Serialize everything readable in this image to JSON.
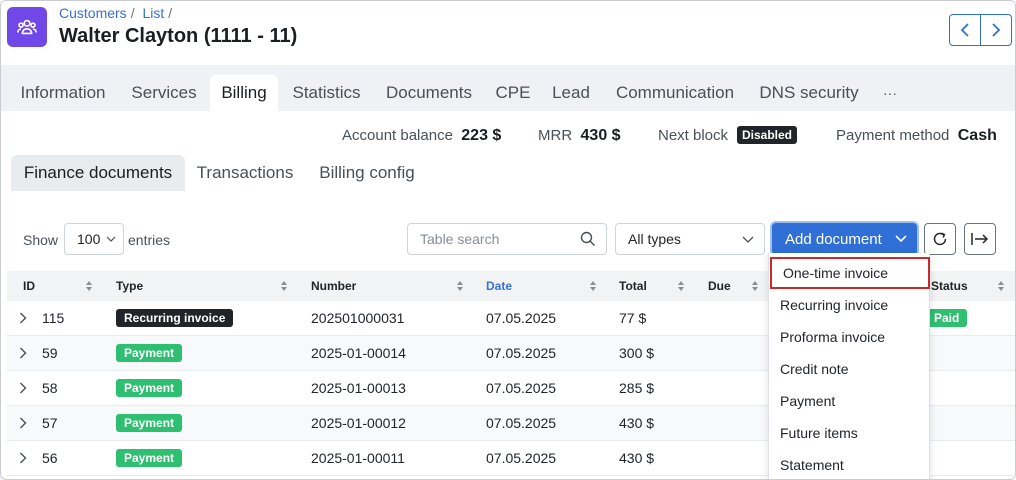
{
  "header": {
    "breadcrumb": [
      "Customers",
      "List"
    ],
    "breadcrumb_sep": "/",
    "title": "Walter Clayton (1111 - 11)",
    "app_icon": "users-group-icon"
  },
  "tabs": [
    "Information",
    "Services",
    "Billing",
    "Statistics",
    "Documents",
    "CPE",
    "Lead",
    "Communication",
    "DNS security",
    "···"
  ],
  "active_tab": "Billing",
  "summary": {
    "account_balance_label": "Account balance",
    "account_balance_value": "223 $",
    "mrr_label": "MRR",
    "mrr_value": "430 $",
    "next_block_label": "Next block",
    "next_block_value": "Disabled",
    "payment_method_label": "Payment method",
    "payment_method_value": "Cash"
  },
  "subtabs": [
    "Finance documents",
    "Transactions",
    "Billing config"
  ],
  "toolbar": {
    "show_label": "Show",
    "show_value": "100",
    "entries_label": "entries",
    "search_placeholder": "Table search",
    "type_filter": "All types",
    "add_document_label": "Add document"
  },
  "table": {
    "columns": [
      "ID",
      "Type",
      "Number",
      "Date",
      "Total",
      "Due",
      "Status"
    ],
    "rows": [
      {
        "id": "115",
        "type": "Recurring invoice",
        "type_style": "dark",
        "number": "202501000031",
        "date": "07.05.2025",
        "total": "77 $",
        "status": "Paid"
      },
      {
        "id": "59",
        "type": "Payment",
        "type_style": "green",
        "number": "2025-01-00014",
        "date": "07.05.2025",
        "total": "300 $",
        "status": ""
      },
      {
        "id": "58",
        "type": "Payment",
        "type_style": "green",
        "number": "2025-01-00013",
        "date": "07.05.2025",
        "total": "285 $",
        "status": ""
      },
      {
        "id": "57",
        "type": "Payment",
        "type_style": "green",
        "number": "2025-01-00012",
        "date": "07.05.2025",
        "total": "430 $",
        "status": ""
      },
      {
        "id": "56",
        "type": "Payment",
        "type_style": "green",
        "number": "2025-01-00011",
        "date": "07.05.2025",
        "total": "430 $",
        "status": ""
      }
    ]
  },
  "dropdown": {
    "items": [
      "One-time invoice",
      "Recurring invoice",
      "Proforma invoice",
      "Credit note",
      "Payment",
      "Future items",
      "Statement"
    ],
    "highlighted": "One-time invoice"
  },
  "colors": {
    "accent": "#2f6fd6",
    "app_icon": "#7048e8",
    "payment_tag": "#2fbf71",
    "recurring_tag": "#212529",
    "highlight_border": "#c92a2a"
  }
}
